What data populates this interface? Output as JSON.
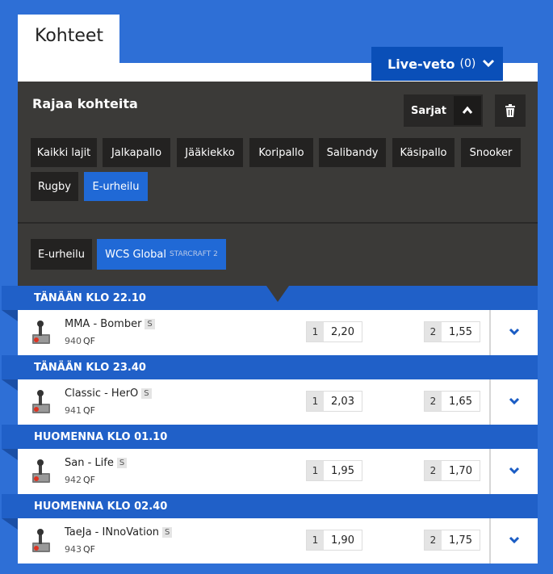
{
  "tab": {
    "title": "Kohteet"
  },
  "live": {
    "label": "Live-veto",
    "count": "(0)"
  },
  "filter": {
    "title": "Rajaa kohteita",
    "series_label": "Sarjat",
    "sports": [
      "Kaikki lajit",
      "Jalkapallo",
      "Jääkiekko",
      "Koripallo",
      "Salibandy",
      "Käsipallo",
      "Snooker",
      "Rugby",
      "E-urheilu"
    ],
    "active_sport": "E-urheilu",
    "sub": {
      "sport": "E-urheilu",
      "league": "WCS Global",
      "league_sub": "STARCRAFT 2"
    }
  },
  "events": [
    {
      "time": "TÄNÄÄN KLO 22.10",
      "teams": "MMA - Bomber",
      "tag": "S",
      "number": "940",
      "qf": "QF",
      "odds": [
        {
          "idx": "1",
          "val": "2,20"
        },
        {
          "idx": "2",
          "val": "1,55"
        }
      ]
    },
    {
      "time": "TÄNÄÄN KLO 23.40",
      "teams": "Classic - HerO",
      "tag": "S",
      "number": "941",
      "qf": "QF",
      "odds": [
        {
          "idx": "1",
          "val": "2,03"
        },
        {
          "idx": "2",
          "val": "1,65"
        }
      ]
    },
    {
      "time": "HUOMENNA KLO 01.10",
      "teams": "San - Life",
      "tag": "S",
      "number": "942",
      "qf": "QF",
      "odds": [
        {
          "idx": "1",
          "val": "1,95"
        },
        {
          "idx": "2",
          "val": "1,70"
        }
      ]
    },
    {
      "time": "HUOMENNA KLO 02.40",
      "teams": "TaeJa - INnoVation",
      "tag": "S",
      "number": "943",
      "qf": "QF",
      "odds": [
        {
          "idx": "1",
          "val": "1,90"
        },
        {
          "idx": "2",
          "val": "1,75"
        }
      ]
    }
  ],
  "colors": {
    "background": "#2e6fd6",
    "panel": "#3b3a38",
    "header": "#2060c8",
    "accent": "#0a4fb8"
  }
}
